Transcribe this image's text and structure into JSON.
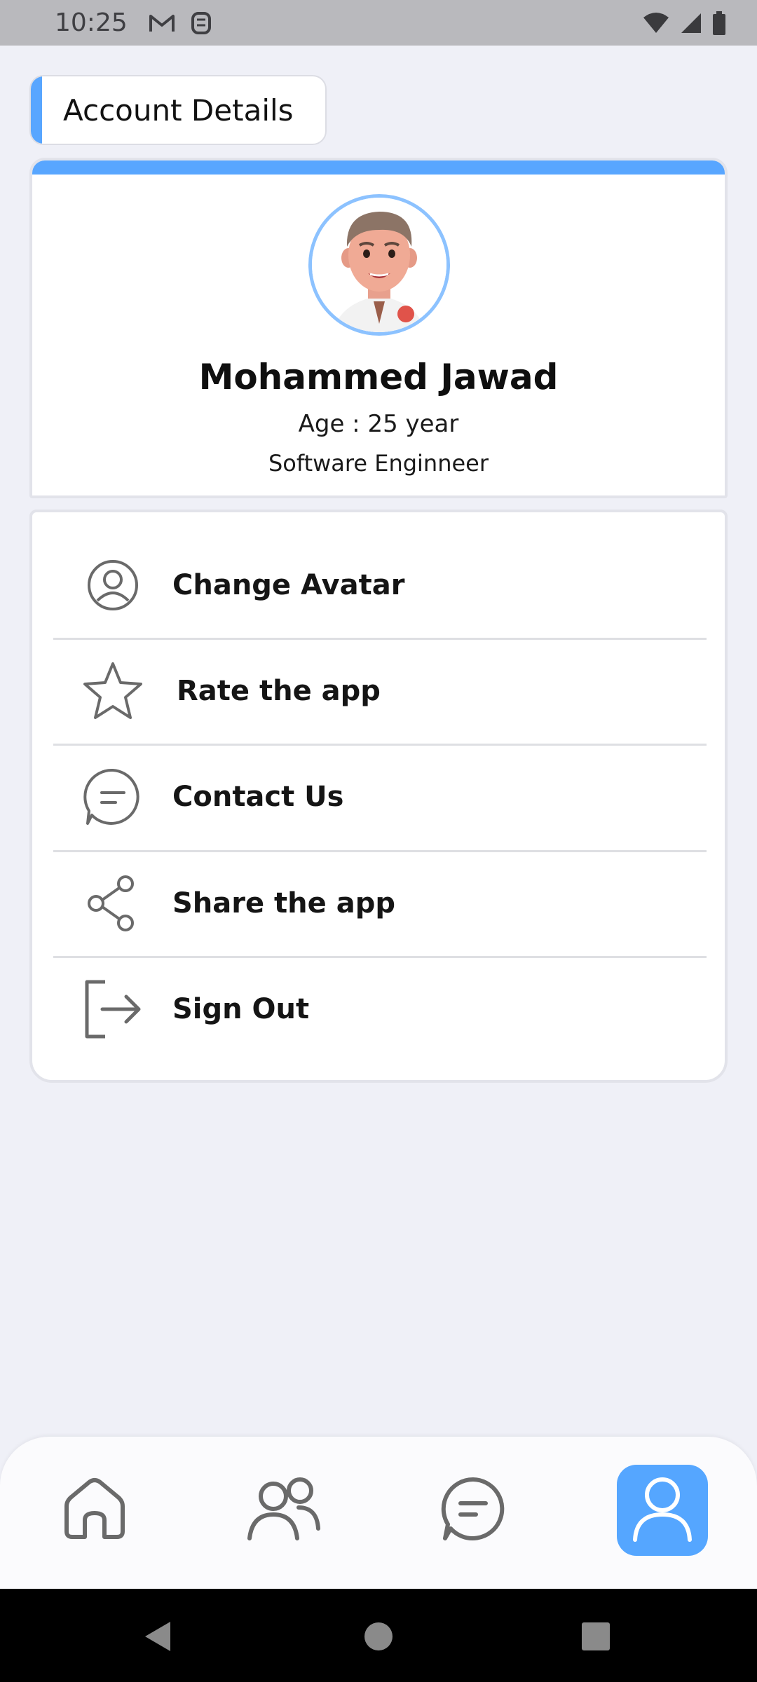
{
  "status_bar": {
    "time": "10:25",
    "left_icons": [
      "gmail-icon",
      "notification-app-icon"
    ],
    "right_icons": [
      "wifi-icon",
      "signal-icon",
      "battery-icon"
    ]
  },
  "section": {
    "title": "Account Details",
    "accent_color": "#58a6ff"
  },
  "profile": {
    "name": "Mohammed Jawad",
    "age": "Age : 25 year",
    "role": "Software Enginneer",
    "avatar_border_color": "#8cc2ff"
  },
  "menu": {
    "items": [
      {
        "label": "Change Avatar",
        "icon": "user-circle-icon"
      },
      {
        "label": "Rate the app",
        "icon": "star-icon"
      },
      {
        "label": "Contact Us",
        "icon": "chat-icon"
      },
      {
        "label": "Share the app",
        "icon": "share-icon"
      },
      {
        "label": "Sign Out",
        "icon": "sign-out-icon"
      }
    ]
  },
  "bottom_nav": {
    "items": [
      {
        "name": "home",
        "icon": "home-icon",
        "active": false
      },
      {
        "name": "friends",
        "icon": "users-icon",
        "active": false
      },
      {
        "name": "messages",
        "icon": "chat-icon",
        "active": false
      },
      {
        "name": "profile",
        "icon": "user-icon",
        "active": true
      }
    ],
    "active_color": "#55a6ff"
  },
  "system_nav": [
    "back-icon",
    "home-circle-icon",
    "recents-icon"
  ]
}
